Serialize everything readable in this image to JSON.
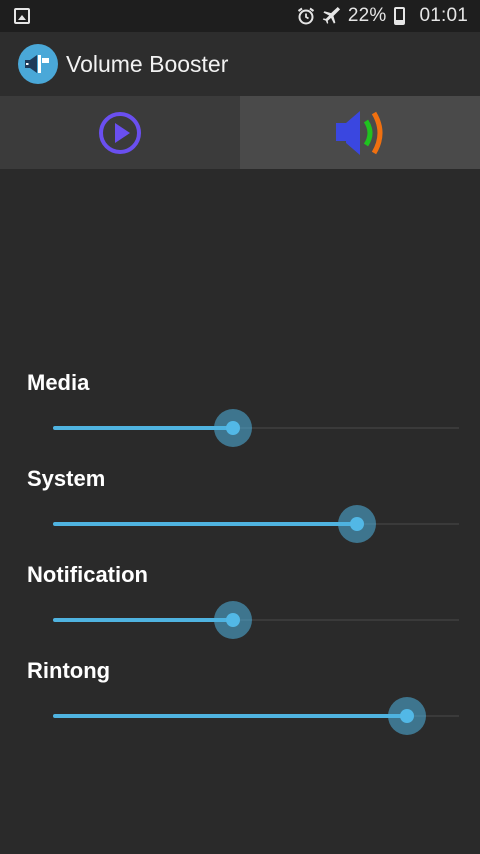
{
  "status_bar": {
    "battery": "22%",
    "time": "01:01",
    "icons": [
      "image-icon",
      "alarm-icon",
      "airplane-icon",
      "battery-icon"
    ]
  },
  "app": {
    "title": "Volume Booster",
    "logo_icon": "volume-booster-logo-icon"
  },
  "tabs": [
    {
      "name": "player",
      "icon": "play-circle-icon",
      "selected": false
    },
    {
      "name": "volume",
      "icon": "speaker-icon",
      "selected": true
    }
  ],
  "sliders": [
    {
      "label": "Media",
      "level": 0.47
    },
    {
      "label": "System",
      "level": 0.8
    },
    {
      "label": "Notification",
      "level": 0.47
    },
    {
      "label": "Rintong",
      "level": 0.93
    }
  ],
  "colors": {
    "accent": "#4fb3e0",
    "play_icon": "#6a4ff0",
    "speaker_blue": "#3a47e0",
    "wave_green": "#1fc21f",
    "wave_orange": "#f07010"
  }
}
